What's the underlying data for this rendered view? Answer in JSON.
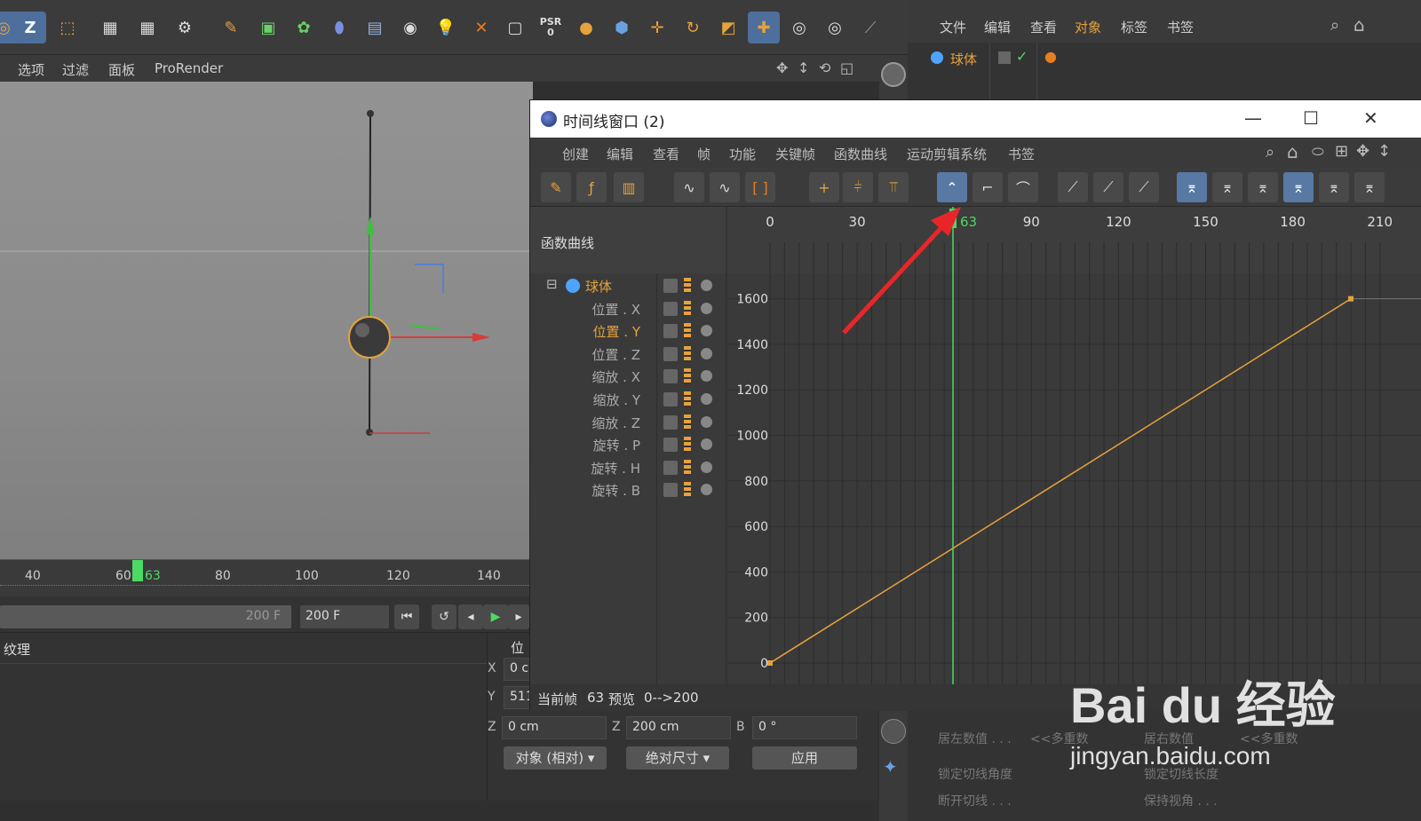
{
  "toolbar": {
    "psr_label": "PSR",
    "psr_value": "0",
    "z_button": "Z"
  },
  "viewport_menu": {
    "items": [
      "选项",
      "过滤",
      "面板",
      "ProRender"
    ]
  },
  "mini_timeline": {
    "ticks": [
      "40",
      "60",
      "63",
      "80",
      "100",
      "120",
      "140"
    ],
    "current_frame": "63",
    "end_field": "200 F",
    "end_field2": "200 F"
  },
  "texture_panel": {
    "title": "纹理"
  },
  "coord_panel": {
    "header": "位",
    "x_label": "X",
    "x_value": "0 c",
    "y_label": "Y",
    "y_value": "511",
    "z_label": "Z",
    "z_value": "0 cm",
    "z2_label": "Z",
    "z2_value": "200 cm",
    "b_label": "B",
    "b_value": "0 °",
    "mode_select": "对象 (相对)",
    "size_select": "绝对尺寸",
    "apply_button": "应用"
  },
  "right_menu": {
    "items": [
      "文件",
      "编辑",
      "查看",
      "对象",
      "标签",
      "书签"
    ]
  },
  "object_manager": {
    "object_name": "球体"
  },
  "attr_panel": {
    "rows": [
      "居左数值 . . .",
      "<<多重数",
      "居右数值",
      "<<多重数",
      "锁定切线角度",
      "锁定切线长度",
      "断开切线 . . .",
      "保持视角 . . ."
    ]
  },
  "timeline_window": {
    "title": "时间线窗口 (2)",
    "menu": [
      "创建",
      "编辑",
      "查看",
      "帧",
      "功能",
      "关键帧",
      "函数曲线",
      "运动剪辑系统",
      "书签"
    ],
    "tree_header": "函数曲线",
    "root": "球体",
    "tracks": [
      "位置 . X",
      "位置 . Y",
      "位置 . Z",
      "缩放 . X",
      "缩放 . Y",
      "缩放 . Z",
      "旋转 . P",
      "旋转 . H",
      "旋转 . B"
    ],
    "selected_track": "位置 . Y",
    "status_frame_label": "当前帧",
    "status_frame_value": "63",
    "status_preview_label": "预览",
    "status_preview_value": "0-->200",
    "ruler_ticks": [
      "0",
      "30",
      "60",
      "90",
      "120",
      "150",
      "180",
      "210"
    ],
    "y_ticks": [
      "0",
      "200",
      "400",
      "600",
      "800",
      "1000",
      "1200",
      "1400",
      "1600"
    ],
    "current_frame_label": "63"
  },
  "curve": {
    "x_frames": [
      0,
      200
    ],
    "y_values": [
      0,
      1600
    ],
    "color": "#e6a23c",
    "playhead_frame": 63,
    "playhead_color": "#4cd964"
  },
  "watermark": {
    "logo": "Bai du 经验",
    "url": "jingyan.baidu.com"
  },
  "icons": [
    "search-icon",
    "home-icon",
    "close-icon",
    "maximize-icon",
    "minimize-icon"
  ]
}
